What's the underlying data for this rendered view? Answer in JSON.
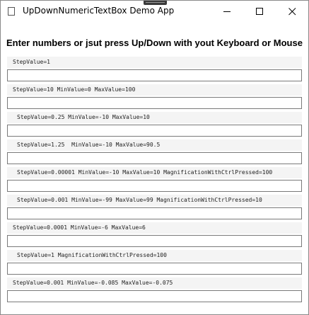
{
  "window": {
    "title": "UpDownNumericTextBox Demo App",
    "buttons": {
      "minimize": "minimize-icon",
      "maximize": "maximize-icon",
      "close": "close-icon"
    }
  },
  "heading": "Enter numbers or jsut press Up/Down with yout Keyboard or Mouse",
  "rows": [
    {
      "label": "StepValue=1",
      "value": ""
    },
    {
      "label": "StepValue=10 MinValue=0 MaxValue=100",
      "value": ""
    },
    {
      "label": "StepValue=0.25 MinValue=-10 MaxValue=10",
      "value": ""
    },
    {
      "label": "StepValue=1.25  MinValue=-10 MaxValue=90.5",
      "value": ""
    },
    {
      "label": "StepValue=0.00001 MinValue=-10 MaxValue=10 MagnificationWithCtrlPressed=100",
      "value": ""
    },
    {
      "label": "StepValue=0.001 MinValue=-99 MaxValue=99 MagnificationWithCtrlPressed=10",
      "value": ""
    },
    {
      "label": "StepValue=0.0001 MinValue=-6 MaxValue=6",
      "value": ""
    },
    {
      "label": "StepValue=1 MagnificationWithCtrlPressed=100",
      "value": ""
    },
    {
      "label": "StepValue=0.001 MinValue=-0.085 MaxValue=-0.075",
      "value": ""
    }
  ]
}
